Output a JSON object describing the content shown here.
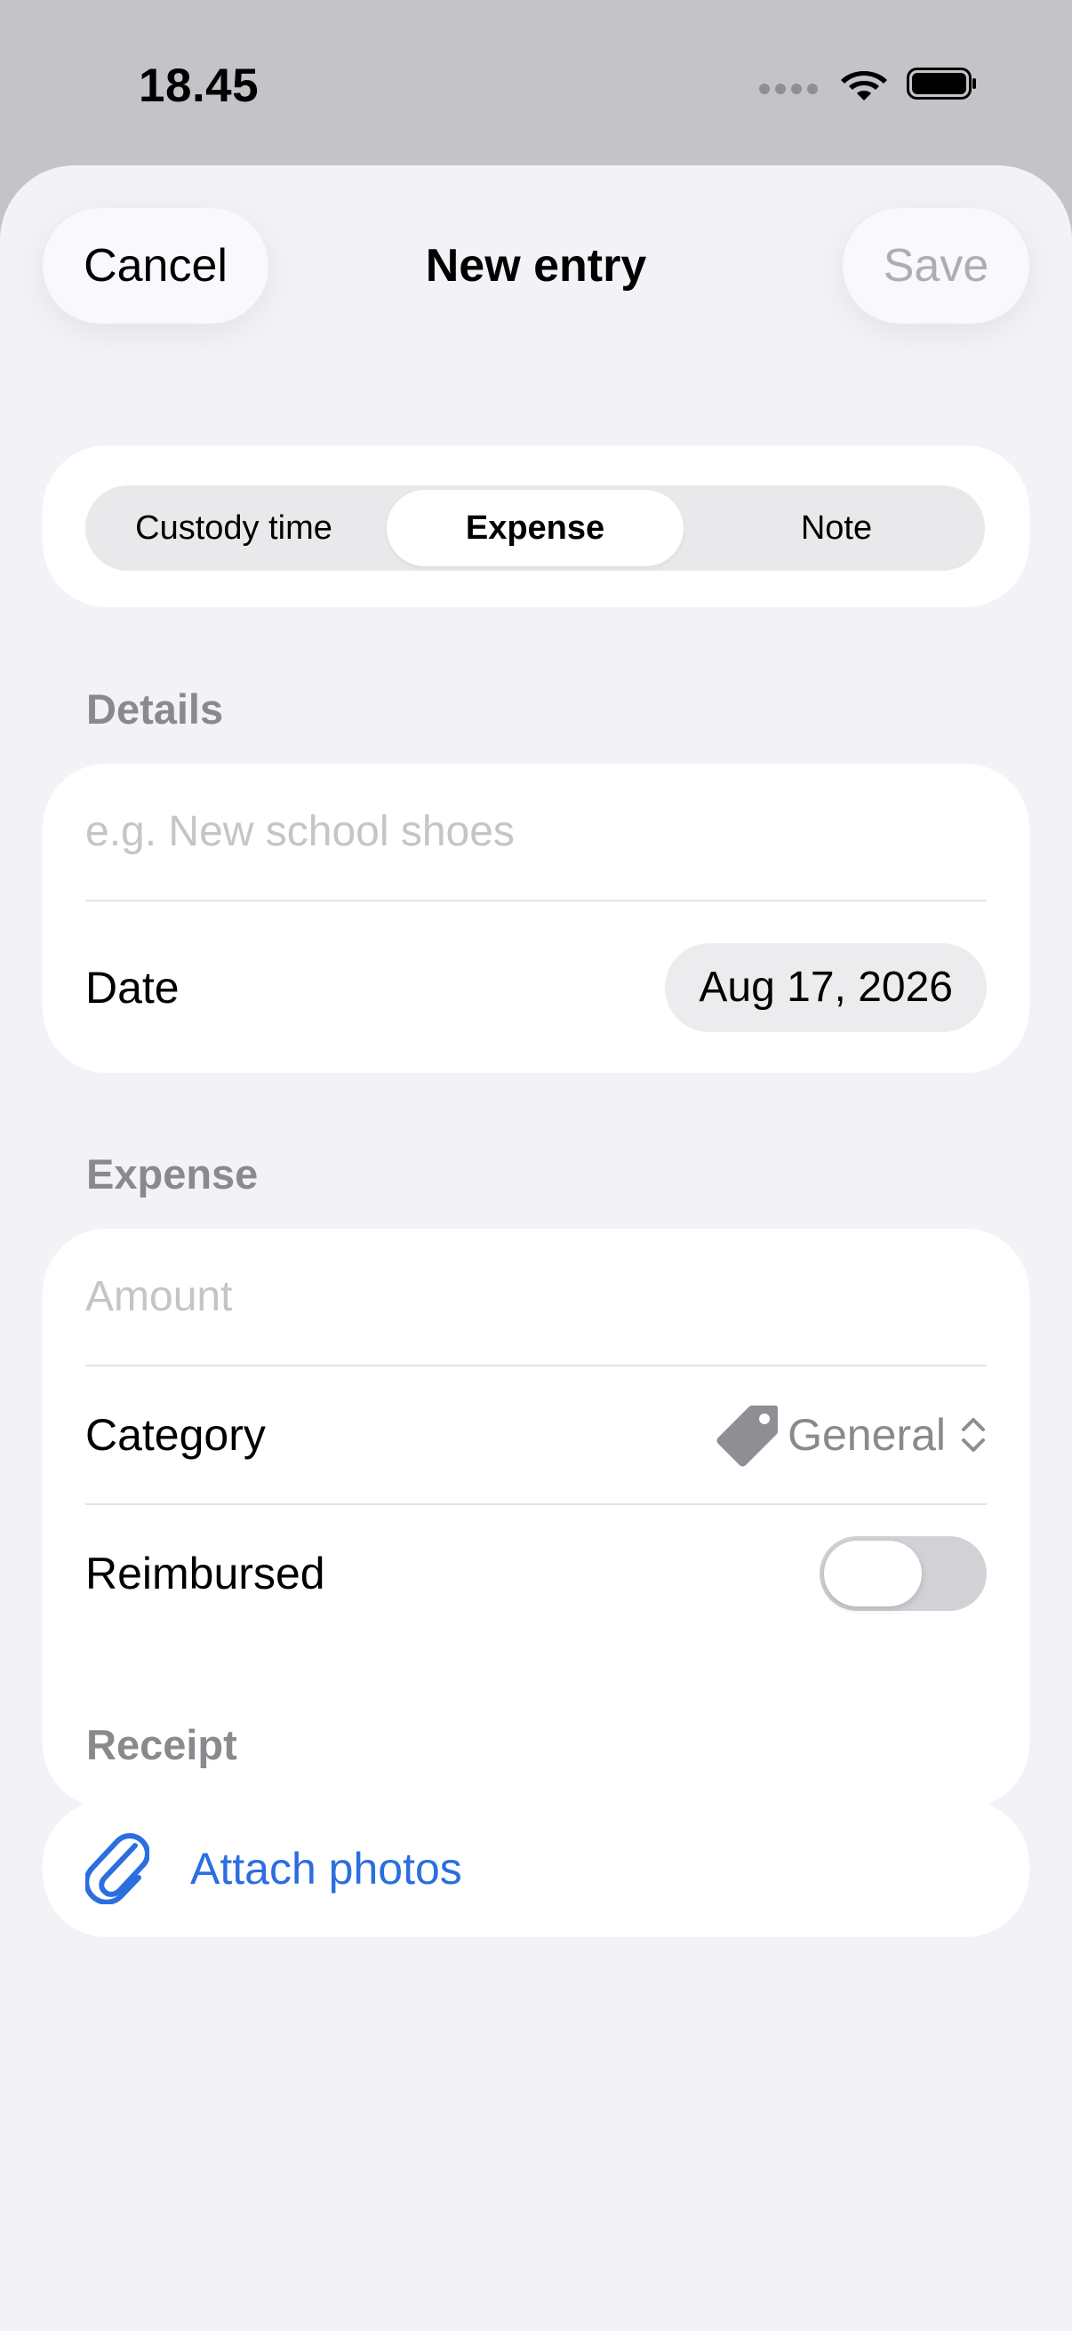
{
  "status_bar": {
    "time": "18.45",
    "icons": [
      "signal-icon",
      "wifi-icon",
      "battery-icon"
    ]
  },
  "nav": {
    "cancel_label": "Cancel",
    "title": "New entry",
    "save_label": "Save"
  },
  "segments": {
    "items": [
      "Custody time",
      "Expense",
      "Note"
    ],
    "selected": "Expense"
  },
  "details": {
    "header": "Details",
    "title_placeholder": "e.g. New school shoes",
    "date_label": "Date",
    "date_value": "Aug 17, 2026"
  },
  "expense": {
    "header": "Expense",
    "amount_placeholder": "Amount",
    "category_label": "Category",
    "category_value": "General",
    "category_icon": "tag-icon",
    "reimbursed_label": "Reimbursed",
    "reimbursed_on": false
  },
  "receipt": {
    "header": "Receipt",
    "attach_label": "Attach photos",
    "attach_icon": "paperclip-icon"
  },
  "colors": {
    "accent": "#2b6ee0",
    "background": "#f2f2f7",
    "secondary_text": "#8a8a8e",
    "placeholder": "#c5c5c7"
  }
}
